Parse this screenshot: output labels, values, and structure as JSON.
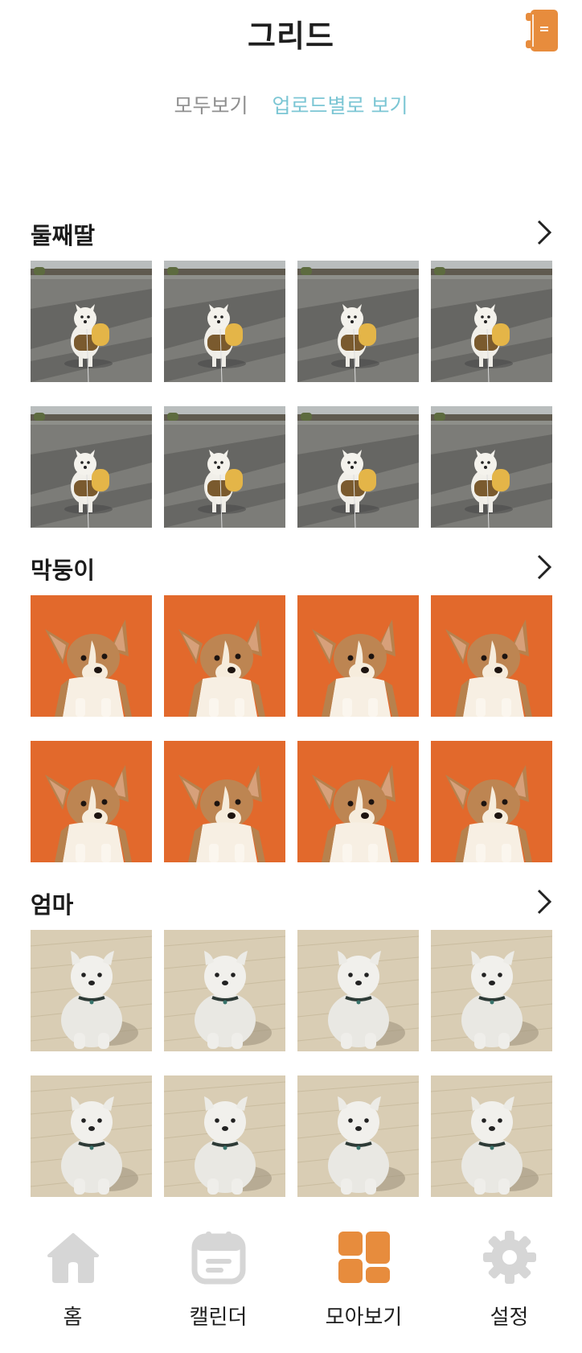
{
  "header": {
    "title": "그리드",
    "book_icon": "book-icon",
    "accent_color": "#e78c3d"
  },
  "tabs": [
    {
      "label": "모두보기",
      "active": false
    },
    {
      "label": "업로드별로 보기",
      "active": true
    }
  ],
  "tab_colors": {
    "active": "#7cc6d4",
    "inactive": "#8f8f8f"
  },
  "sections": [
    {
      "title": "둘째딸",
      "arrow_icon": "chevron-right-icon",
      "photo_subject": "white-dog-on-road",
      "photo_count": 8
    },
    {
      "title": "막둥이",
      "arrow_icon": "chevron-right-icon",
      "photo_subject": "corgi-puppy-orange-background",
      "photo_count": 8
    },
    {
      "title": "엄마",
      "arrow_icon": "chevron-right-icon",
      "photo_subject": "white-dog-sitting-on-floor",
      "photo_count": 8
    }
  ],
  "bottom_nav": [
    {
      "label": "홈",
      "icon": "home-icon",
      "active": false
    },
    {
      "label": "캘린더",
      "icon": "calendar-icon",
      "active": false
    },
    {
      "label": "모아보기",
      "icon": "grid-icon",
      "active": true
    },
    {
      "label": "설정",
      "icon": "gear-icon",
      "active": false
    }
  ],
  "nav_colors": {
    "active": "#e78c3d",
    "inactive": "#d6d6d6"
  }
}
